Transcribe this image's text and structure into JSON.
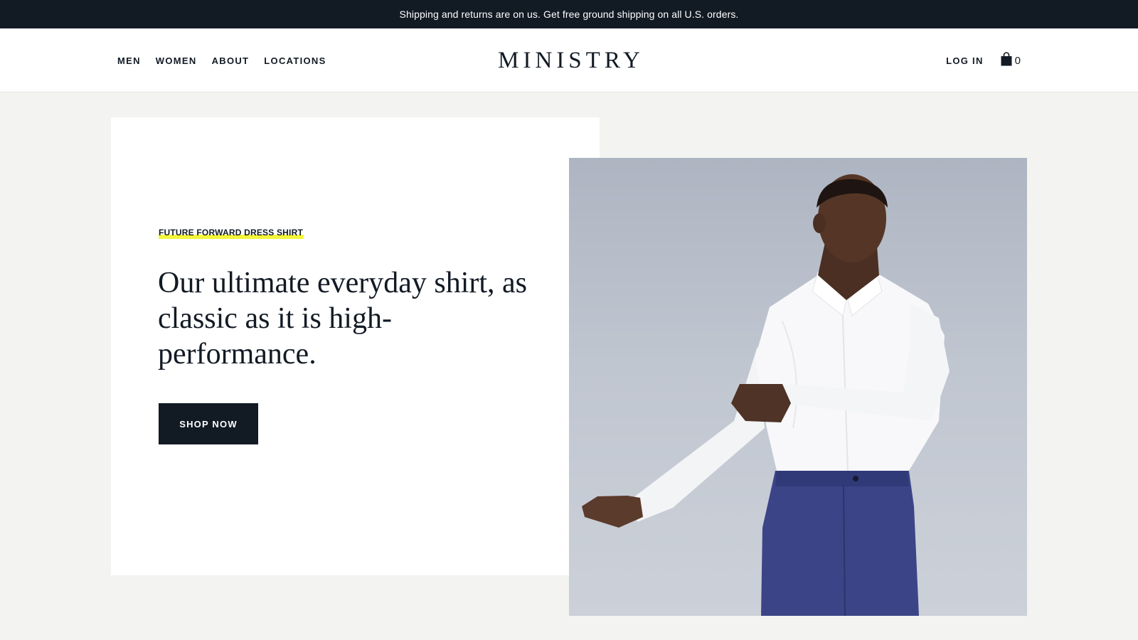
{
  "announcement": "Shipping and returns are on us. Get free ground shipping on all U.S. orders.",
  "nav": {
    "left": [
      "MEN",
      "WOMEN",
      "ABOUT",
      "LOCATIONS"
    ],
    "logo": "MINISTRY",
    "login": "LOG IN",
    "cart_icon": "shopping-bag-icon",
    "cart_count": "0"
  },
  "hero": {
    "eyebrow": "FUTURE FORWARD DRESS SHIRT",
    "headline": "Our ultimate everyday shirt, as classic as it is high-performance.",
    "cta": "SHOP NOW",
    "image": "model-in-white-dress-shirt"
  },
  "colors": {
    "dark": "#121a24",
    "highlight": "#f4f63a",
    "page_bg": "#f3f3f1",
    "card_bg": "#ffffff"
  }
}
